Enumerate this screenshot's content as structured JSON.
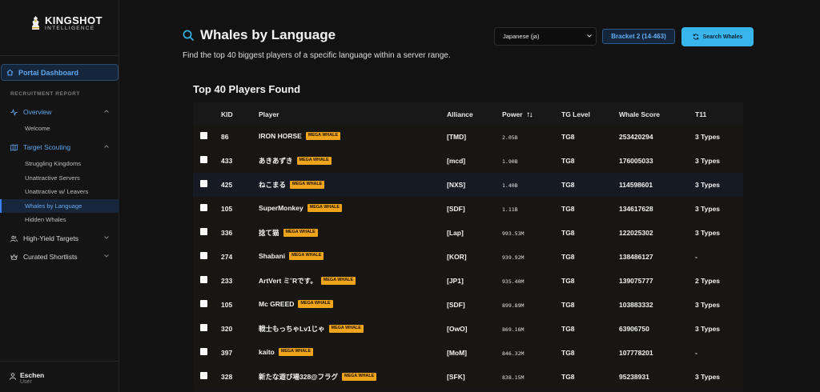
{
  "brand": {
    "name": "KINGSHOT",
    "tagline": "INTELLIGENCE"
  },
  "sidebar": {
    "portal_label": "Portal Dashboard",
    "section_label": "RECRUITMENT REPORT",
    "overview": {
      "label": "Overview",
      "items": [
        "Welcome"
      ]
    },
    "scouting": {
      "label": "Target Scouting",
      "items": [
        "Struggling Kingdoms",
        "Unattractive Servers",
        "Unattractive w/ Leavers",
        "Whales by Language",
        "Hidden Whales"
      ]
    },
    "high_yield": {
      "label": "High-Yield Targets"
    },
    "shortlists": {
      "label": "Curated Shortlists"
    },
    "user": {
      "name": "Eschen",
      "role": "User"
    }
  },
  "header": {
    "title": "Whales by Language",
    "subtitle": "Find the top 40 biggest players of a specific language within a server range.",
    "language_value": "Japanese (ja)",
    "bracket_label": "Bracket 2 (14-463)",
    "search_button": "Search Whales"
  },
  "results": {
    "title": "Top 40 Players Found",
    "columns": [
      "KID",
      "Player",
      "Alliance",
      "Power",
      "TG Level",
      "Whale Score",
      "T11"
    ],
    "badge": "MEGA WHALE",
    "rows": [
      {
        "kid": "86",
        "player": "IRON HORSE",
        "alliance": "[TMD]",
        "power": "2.05B",
        "tg": "TG8",
        "score": "253420294",
        "t11": "3 Types"
      },
      {
        "kid": "433",
        "player": "あきあずき",
        "alliance": "[mcd]",
        "power": "1.90B",
        "tg": "TG8",
        "score": "176005033",
        "t11": "3 Types"
      },
      {
        "kid": "425",
        "player": "ねこまる",
        "alliance": "[NXS]",
        "power": "1.40B",
        "tg": "TG8",
        "score": "114598601",
        "t11": "3 Types"
      },
      {
        "kid": "105",
        "player": "SuperMonkey",
        "alliance": "[SDF]",
        "power": "1.11B",
        "tg": "TG8",
        "score": "134617628",
        "t11": "3 Types"
      },
      {
        "kid": "336",
        "player": "捻て猫",
        "alliance": "[Lap]",
        "power": "993.53M",
        "tg": "TG8",
        "score": "122025302",
        "t11": "3 Types"
      },
      {
        "kid": "274",
        "player": "Shabani",
        "alliance": "[KOR]",
        "power": "939.92M",
        "tg": "TG8",
        "score": "138486127",
        "t11": "-"
      },
      {
        "kid": "233",
        "player": "ArtVert ミ˚Rです。",
        "alliance": "[JP1]",
        "power": "935.40M",
        "tg": "TG8",
        "score": "139075777",
        "t11": "2 Types"
      },
      {
        "kid": "105",
        "player": "Mc GREED",
        "alliance": "[SDF]",
        "power": "899.89M",
        "tg": "TG8",
        "score": "103883332",
        "t11": "3 Types"
      },
      {
        "kid": "320",
        "player": "戦士もっちゃLv1じゃ",
        "alliance": "[OwO]",
        "power": "869.16M",
        "tg": "TG8",
        "score": "63906750",
        "t11": "3 Types"
      },
      {
        "kid": "397",
        "player": "kaito",
        "alliance": "[MoM]",
        "power": "846.32M",
        "tg": "TG8",
        "score": "107778201",
        "t11": "-"
      },
      {
        "kid": "328",
        "player": "新たな遊び場328@フラグ",
        "alliance": "[SFK]",
        "power": "838.15M",
        "tg": "TG8",
        "score": "95238931",
        "t11": "3 Types"
      }
    ]
  },
  "colors": {
    "accent": "#38b6ec",
    "link": "#5ea8f2",
    "badge": "#f0a41c",
    "bg": "#121212"
  }
}
